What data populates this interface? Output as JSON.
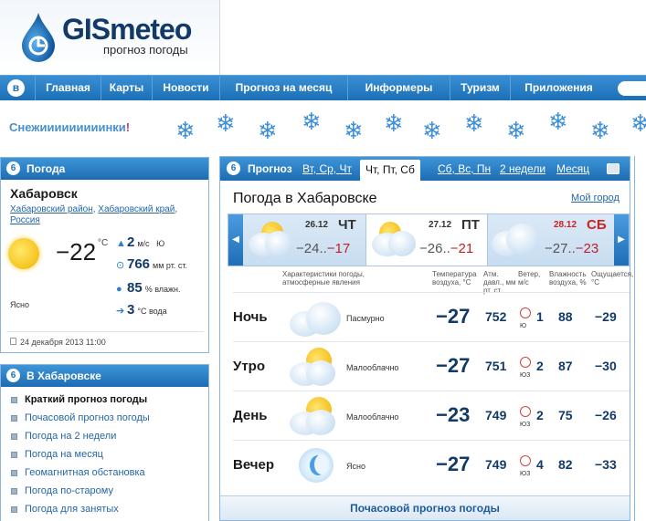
{
  "header": {
    "logo_text": "GISmeteo",
    "logo_sub": "прогноз погоды"
  },
  "nav": {
    "b_icon": "в",
    "items": [
      "Главная",
      "Карты",
      "Новости",
      "Прогноз на месяц",
      "Информеры",
      "Туризм",
      "Приложения"
    ]
  },
  "banner": {
    "text": "Снежииииииииинки",
    "exclaim": "!",
    "flake_icon": "snowflake-icon",
    "color": "#4a8fd0"
  },
  "left_weather": {
    "title": "Погода",
    "city": "Хабаровск",
    "region_links": [
      "Хабаровский район",
      "Хабаровский край",
      "Россия"
    ],
    "temp": "−22",
    "temp_unit": "°C",
    "condition": "Ясно",
    "wind_value": "2",
    "wind_unit": "м/с",
    "wind_dir": "Ю",
    "pressure_value": "766",
    "pressure_unit": "мм рт. ст.",
    "humidity_value": "85",
    "humidity_unit": "% влажн.",
    "water_value": "3",
    "water_unit": "°С вода",
    "date": "24 декабря 2013 11:00"
  },
  "left_links": {
    "title": "В Хабаровске",
    "items": [
      "Краткий прогноз погоды",
      "Почасовой прогноз погоды",
      "Погода на 2 недели",
      "Погода на месяц",
      "Геомагнитная обстановка",
      "Погода по-старому",
      "Погода для занятых"
    ]
  },
  "main": {
    "tabs": [
      "Прогноз",
      "Вт, Ср, Чт",
      "Чт, Пт, Сб",
      "Сб, Вс, Пн",
      "2 недели",
      "Месяц"
    ],
    "title": "Погода в Хабаровске",
    "my_city": "Мой город",
    "days": [
      {
        "date": "26.12",
        "name": "ЧТ",
        "tmin": "−24..",
        "tmax": "−17",
        "red": false
      },
      {
        "date": "27.12",
        "name": "ПТ",
        "tmin": "−26..",
        "tmax": "−21",
        "red": false
      },
      {
        "date": "28.12",
        "name": "СБ",
        "tmin": "−27..",
        "tmax": "−23",
        "red": true
      }
    ],
    "columns": {
      "cond": "Характеристики погоды, атмосферные явления",
      "temp": "Температура воздуха, °С",
      "press": "Атм. давл., мм рт. ст.",
      "wind": "Ветер, м/с",
      "hum": "Влажность воздуха, %",
      "feel": "Ощущается, °С"
    },
    "rows": [
      {
        "name": "Ночь",
        "cond": "Пасмурно",
        "temp": "−27",
        "press": "752",
        "wdir": "Ю",
        "wind": "1",
        "hum": "88",
        "feel": "−29",
        "icon": "overcast-icon"
      },
      {
        "name": "Утро",
        "cond": "Малооблачно",
        "temp": "−27",
        "press": "751",
        "wdir": "ЮЗ",
        "wind": "2",
        "hum": "87",
        "feel": "−30",
        "icon": "partly-cloudy-icon"
      },
      {
        "name": "День",
        "cond": "Малооблачно",
        "temp": "−23",
        "press": "749",
        "wdir": "ЮЗ",
        "wind": "2",
        "hum": "75",
        "feel": "−26",
        "icon": "partly-cloudy-icon"
      },
      {
        "name": "Вечер",
        "cond": "Ясно",
        "temp": "−27",
        "press": "749",
        "wdir": "ЮЗ",
        "wind": "4",
        "hum": "82",
        "feel": "−33",
        "icon": "moon-clear-icon"
      }
    ],
    "hourly_button": "Почасовой прогноз погоды"
  }
}
